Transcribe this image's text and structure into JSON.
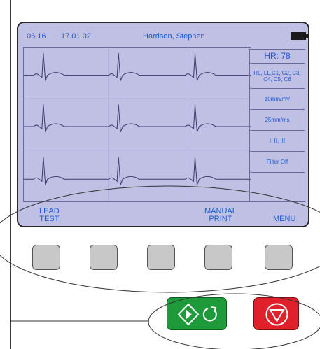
{
  "header": {
    "time": "06.16",
    "date": "17.01.02",
    "patient_name": "Harrison, Stephen",
    "battery_icon": "battery-icon"
  },
  "side_panel": {
    "heart_rate": "HR: 78",
    "leads": "RL, LL,C1, C2, C3, C4, C5, C6",
    "sensitivity": "10mm/mV",
    "speed": "25mm/ms",
    "lead_group": "I, II, III",
    "filter": "Filter Off"
  },
  "softkeys": {
    "lead_test_line1": "LEAD",
    "lead_test_line2": "TEST",
    "manual_print_line1": "MANUAL",
    "manual_print_line2": "PRINT",
    "menu": "MENU"
  },
  "controls": {
    "start_icon": "start-copy-icon",
    "stop_icon": "stop-icon"
  },
  "colors": {
    "screen_bg": "#c0c0e4",
    "text": "#1c5bd0",
    "trace": "#3a3a6e",
    "start_button": "#1e9a3a",
    "stop_button": "#e0202a"
  }
}
